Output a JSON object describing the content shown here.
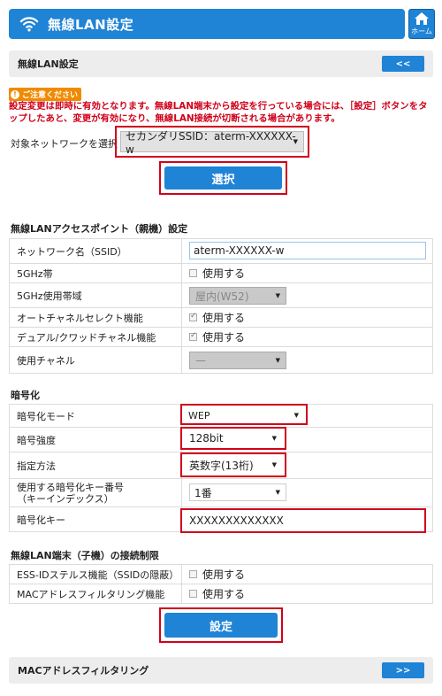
{
  "header": {
    "title": "無線LAN設定",
    "home_label": "ホーム"
  },
  "subbar": {
    "title": "無線LAN設定",
    "back_label": "<<"
  },
  "notice": {
    "badge": "ご注意ください",
    "text": "設定変更は即時に有効となります。無線LAN端末から設定を行っている場合には、［設定］ボタンをタップしたあと、変更が有効になり、無線LAN接続が切断される場合があります。"
  },
  "network_select": {
    "label": "対象ネットワークを選択",
    "value": "セカンダリSSID：aterm-XXXXXX-w",
    "button": "選択"
  },
  "ap_section": {
    "title": "無線LANアクセスポイント（親機）設定",
    "ssid_label": "ネットワーク名（SSID）",
    "ssid_value": "aterm-XXXXXX-w",
    "band5_label": "5GHz帯",
    "band5_option": "使用する",
    "band5use_label": "5GHz使用帯域",
    "band5use_value": "屋内(W52)",
    "autochannel_label": "オートチャネルセレクト機能",
    "autochannel_option": "使用する",
    "dualquad_label": "デュアル/クワッドチャネル機能",
    "dualquad_option": "使用する",
    "channel_label": "使用チャネル",
    "channel_value": "—"
  },
  "enc_section": {
    "title": "暗号化",
    "mode_label": "暗号化モード",
    "mode_value": "WEP",
    "strength_label": "暗号強度",
    "strength_value": "128bit",
    "method_label": "指定方法",
    "method_value": "英数字(13桁)",
    "keyindex_label_line1": "使用する暗号化キー番号",
    "keyindex_label_line2": "（キーインデックス）",
    "keyindex_value": "1番",
    "key_label": "暗号化キー",
    "key_value": "XXXXXXXXXXXXX"
  },
  "conn_section": {
    "title": "無線LAN端末（子機）の接続制限",
    "stealth_label": "ESS-IDステルス機能（SSIDの隠蔽）",
    "stealth_option": "使用する",
    "macfilter_label": "MACアドレスフィルタリング機能",
    "macfilter_option": "使用する"
  },
  "apply_button": "設定",
  "bottom_bar": {
    "title": "MACアドレスフィルタリング",
    "next_label": ">>"
  },
  "colors": {
    "primary": "#1f83d6",
    "highlight": "#d0021b",
    "warning": "#f08a00"
  }
}
